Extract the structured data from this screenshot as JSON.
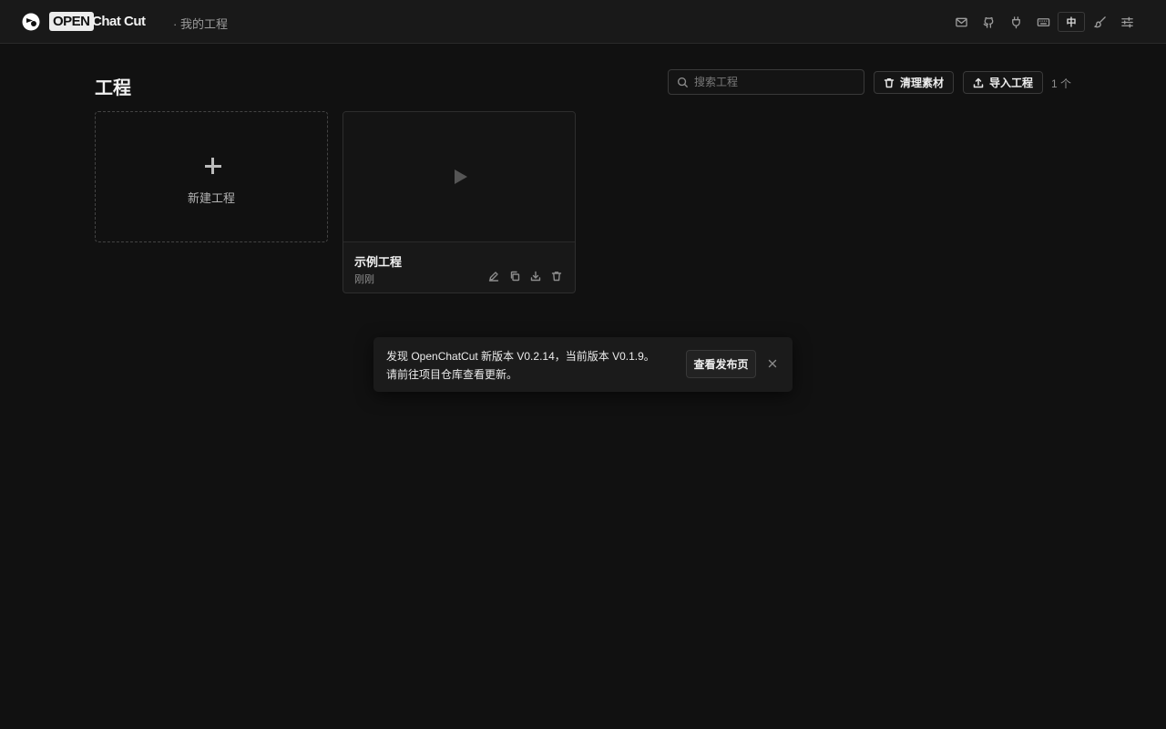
{
  "header": {
    "brand_open": "OPEN",
    "brand_chatcut": "Chat Cut",
    "breadcrumb": "· 我的工程",
    "lang_label": "中",
    "icons": [
      "mail-icon",
      "github-icon",
      "plug-icon",
      "keyboard-icon",
      "language-toggle",
      "brush-icon",
      "settings-sliders-icon"
    ]
  },
  "page": {
    "title": "工程",
    "search_placeholder": "搜索工程",
    "clean_label": "清理素材",
    "import_label": "导入工程",
    "count": "1 个"
  },
  "new_project": {
    "label": "新建工程"
  },
  "projects": [
    {
      "name": "示例工程",
      "time": "刚刚"
    }
  ],
  "toast": {
    "line1": "发现 OpenChatCut 新版本 V0.2.14，当前版本 V0.1.9。",
    "line2": "请前往项目仓库查看更新。",
    "button": "查看发布页"
  }
}
